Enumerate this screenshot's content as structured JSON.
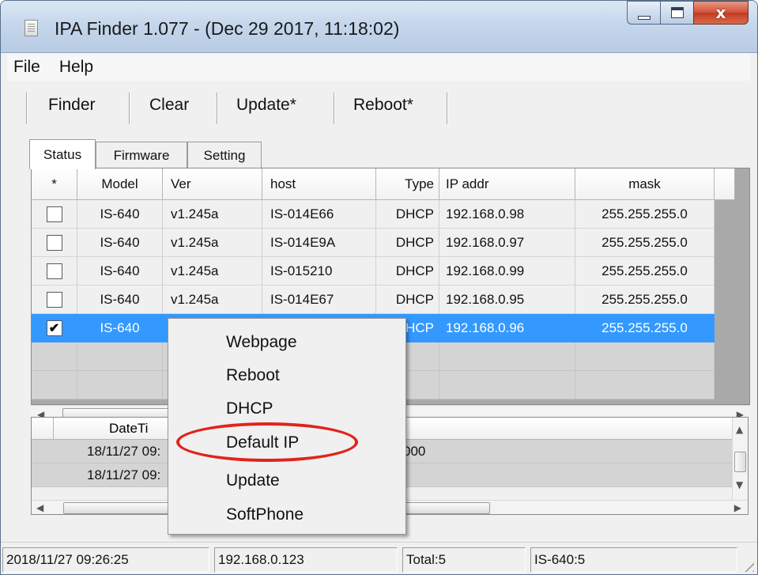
{
  "window": {
    "title": "IPA Finder 1.077 - (Dec 29 2017, 11:18:02)",
    "close_glyph": "x"
  },
  "menubar": {
    "items": [
      "File",
      "Help"
    ]
  },
  "toolbar": {
    "buttons": [
      "Finder",
      "Clear",
      "Update*",
      "Reboot*"
    ]
  },
  "tabs": [
    "Status",
    "Firmware",
    "Setting"
  ],
  "grid": {
    "columns": [
      "*",
      "Model",
      "Ver",
      "host",
      "Type",
      "IP addr",
      "mask"
    ],
    "rows": [
      {
        "checked": false,
        "model": "IS-640",
        "ver": "v1.245a",
        "host": "IS-014E66",
        "type": "DHCP",
        "ip": "192.168.0.98",
        "mask": "255.255.255.0"
      },
      {
        "checked": false,
        "model": "IS-640",
        "ver": "v1.245a",
        "host": "IS-014E9A",
        "type": "DHCP",
        "ip": "192.168.0.97",
        "mask": "255.255.255.0"
      },
      {
        "checked": false,
        "model": "IS-640",
        "ver": "v1.245a",
        "host": "IS-015210",
        "type": "DHCP",
        "ip": "192.168.0.99",
        "mask": "255.255.255.0"
      },
      {
        "checked": false,
        "model": "IS-640",
        "ver": "v1.245a",
        "host": "IS-014E67",
        "type": "DHCP",
        "ip": "192.168.0.95",
        "mask": "255.255.255.0"
      },
      {
        "checked": true,
        "model": "IS-640",
        "ver": "",
        "host": "",
        "type": "HCP",
        "ip": "192.168.0.96",
        "mask": "255.255.255.0",
        "check_glyph": "✔"
      }
    ],
    "selected_row_color": "#3399ff"
  },
  "log": {
    "header_fragment": "DateTi",
    "rows": [
      {
        "time": "18/11/27 09:",
        "tail": "000"
      },
      {
        "time": "18/11/27 09:",
        "tail": ""
      }
    ]
  },
  "context_menu": {
    "items": [
      "Webpage",
      "Reboot",
      "DHCP",
      "Default IP",
      "Update",
      "SoftPhone"
    ],
    "highlighted": "Default IP",
    "highlight_color": "#e0241c"
  },
  "statusbar": {
    "datetime": "2018/11/27 09:26:25",
    "local_ip": "192.168.0.123",
    "total": "Total:5",
    "model_count": "IS-640:5"
  }
}
